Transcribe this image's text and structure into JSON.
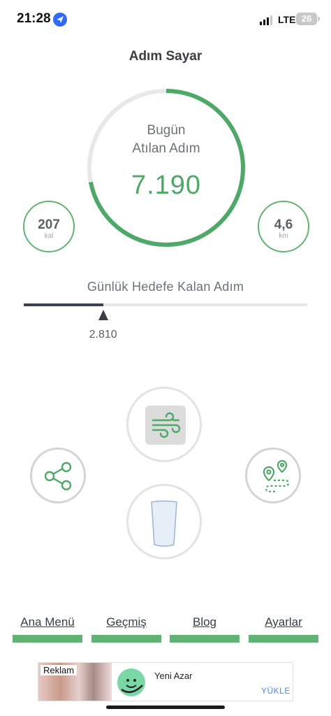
{
  "status": {
    "time": "21:28",
    "network": "LTE",
    "battery": "26"
  },
  "app": {
    "title": "Adım Sayar"
  },
  "today": {
    "line1": "Bugün",
    "line2": "Atılan Adım",
    "steps": "7.190",
    "progress": 0.72
  },
  "calories": {
    "value": "207",
    "unit": "kal"
  },
  "distance": {
    "value": "4,6",
    "unit": "km"
  },
  "goal": {
    "label": "Günlük Hedefe Kalan Adım",
    "remaining": "2.810",
    "progress": 0.28
  },
  "actions": {
    "wind_icon": "wind-icon",
    "share_icon": "share-icon",
    "route_icon": "route-map-icon",
    "water_icon": "water-glass-icon"
  },
  "nav": [
    {
      "label": "Ana Menü"
    },
    {
      "label": "Geçmiş"
    },
    {
      "label": "Blog"
    },
    {
      "label": "Ayarlar"
    }
  ],
  "ad": {
    "tag": "Reklam",
    "name": "Yeni Azar",
    "cta": "YÜKLE"
  },
  "colors": {
    "accent": "#4ea867",
    "ring_track": "#e8e8e8",
    "nav_bar": "#62b274"
  }
}
